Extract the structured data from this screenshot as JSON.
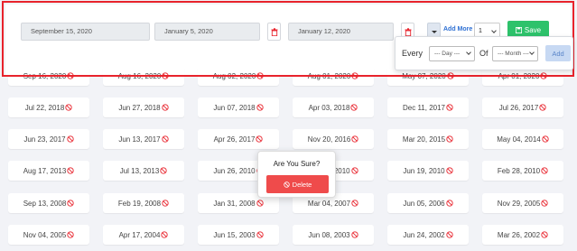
{
  "toolbar": {
    "date_fields": [
      "September 15, 2020",
      "January 5, 2020",
      "January 12, 2020"
    ],
    "add_more_label": "Add More",
    "count_select_value": "1",
    "save_label": "Save"
  },
  "every_panel": {
    "every_label": "Every",
    "day_placeholder": "--- Day ---",
    "of_label": "Of",
    "month_placeholder": "--- Month ---",
    "add_label": "Add"
  },
  "dates": [
    [
      "Sep 16, 2020",
      "Aug 16, 2020",
      "Aug 02, 2020",
      "Aug 01, 2020",
      "May 07, 2020",
      "Apr 01, 2020"
    ],
    [
      "Jul 22, 2018",
      "Jun 27, 2018",
      "Jun 07, 2018",
      "Apr 03, 2018",
      "Dec 11, 2017",
      "Jul 26, 2017"
    ],
    [
      "Jun 23, 2017",
      "Jun 13, 2017",
      "Apr 26, 2017",
      "Nov 20, 2016",
      "Mar 20, 2015",
      "May 04, 2014"
    ],
    [
      "Aug 17, 2013",
      "Jul 13, 2013",
      "Jun 26, 2010",
      "Jun 19, 2010",
      "Jun 19, 2010",
      "Feb 28, 2010"
    ],
    [
      "Sep 13, 2008",
      "Feb 19, 2008",
      "Jan 31, 2008",
      "Mar 04, 2007",
      "Jun 05, 2006",
      "Nov 29, 2005"
    ],
    [
      "Nov 04, 2005",
      "Apr 17, 2004",
      "Jun 15, 2003",
      "Jun 08, 2003",
      "Jun 24, 2002",
      "Mar 26, 2002"
    ]
  ],
  "popover": {
    "title": "Are You Sure?",
    "delete_label": "Delete"
  },
  "colors": {
    "save": "#2dc26b",
    "delete": "#ef4b4b",
    "ban_icon": "#e8232c",
    "add_more": "#2d6fd3",
    "highlight": "#e8232c"
  }
}
